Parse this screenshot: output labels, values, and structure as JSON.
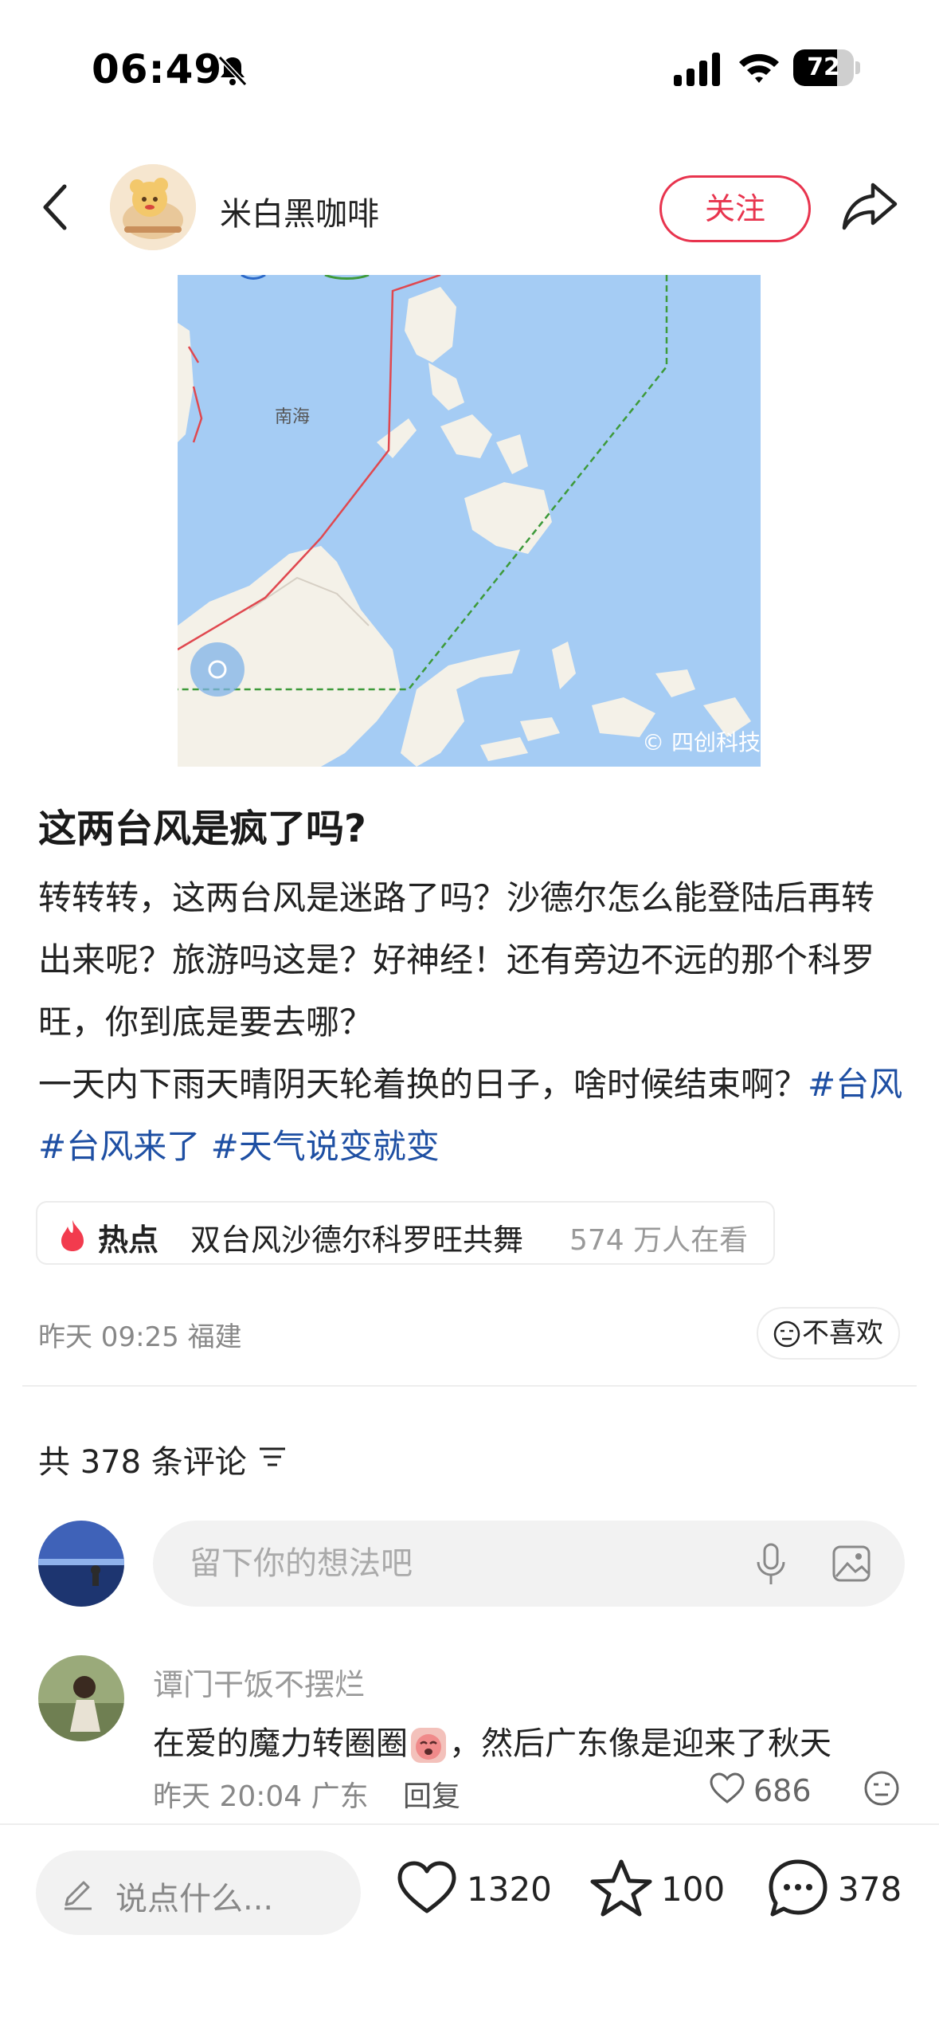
{
  "status_bar": {
    "time": "06:49",
    "battery_level": "72",
    "battery_fraction": 0.72
  },
  "header": {
    "author_name": "米白黑咖啡",
    "follow_label": "关注"
  },
  "map": {
    "sea_label": "南海",
    "watermark": "© 四创科技",
    "colors": {
      "sea": "#a5ccf4",
      "land": "#f4f1e8",
      "route_red": "#e0484f",
      "route_green": "#3d9a3a"
    }
  },
  "post": {
    "title": "这两台风是疯了吗?",
    "paragraph1": "转转转，这两台风是迷路了吗？沙德尔怎么能登陆后再转出来呢？旅游吗这是？好神经！还有旁边不远的那个科罗旺，你到底是要去哪？",
    "paragraph2_text": "一天内下雨天晴阴天轮着换的日子，啥时候结束啊？",
    "hashtags": [
      "#台风",
      "#台风来了",
      "#天气说变就变"
    ],
    "hot_topic": {
      "label": "热点",
      "title": "双台风沙德尔科罗旺共舞",
      "viewers": "574 万人在看"
    },
    "meta": "昨天 09:25 福建",
    "dislike_label": "不喜欢"
  },
  "comments": {
    "header": "共 378 条评论",
    "input_placeholder": "留下你的想法吧",
    "items": [
      {
        "user": "谭门干饭不摆烂",
        "text_before": "在爱的魔力转圈圈",
        "text_after": "，然后广东像是迎来了秋天",
        "meta": "昨天 20:04 广东",
        "reply_label": "回复",
        "likes": "686"
      }
    ]
  },
  "bottom_bar": {
    "say_placeholder": "说点什么...",
    "likes": "1320",
    "stars": "100",
    "comments": "378"
  },
  "icons": [
    "bell-off-icon",
    "signal-icon",
    "wifi-icon",
    "battery-icon",
    "back-icon",
    "share-icon",
    "flame-icon",
    "dislike-face-icon",
    "sort-icon",
    "mic-icon",
    "image-icon",
    "heart-icon",
    "star-icon",
    "comment-icon",
    "pencil-icon"
  ],
  "accent_colors": {
    "brand_red": "#e8344e",
    "hashtag_blue": "#1e4fa3"
  }
}
